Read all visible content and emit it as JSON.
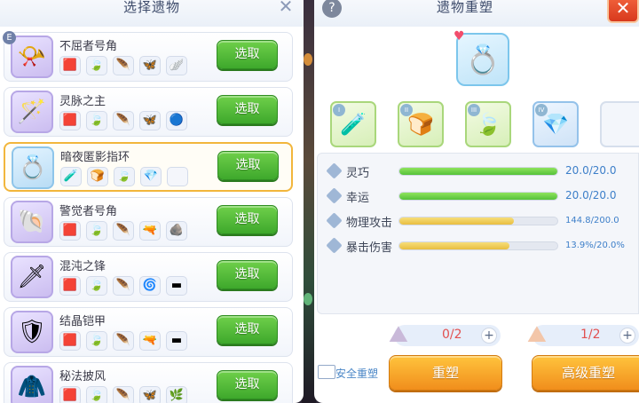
{
  "left_panel": {
    "title": "选择遗物",
    "close_icon": "close-icon",
    "badge": "E",
    "pick_label": "选取",
    "relics": [
      {
        "name": "不屈者号角",
        "icon": "horn",
        "glyph": "📯",
        "selected": false,
        "slots": [
          "🟥",
          "🍃",
          "🪶",
          "🦋",
          "🪽"
        ]
      },
      {
        "name": "灵脉之主",
        "icon": "staff",
        "glyph": "🪄",
        "selected": false,
        "slots": [
          "🟥",
          "🍃",
          "🪶",
          "🦋",
          "🔵"
        ]
      },
      {
        "name": "暗夜匿影指环",
        "icon": "ring",
        "glyph": "💍",
        "selected": true,
        "slots": [
          "🧪",
          "🍞",
          "🍃",
          "💎",
          ""
        ]
      },
      {
        "name": "警觉者号角",
        "icon": "horn-blue",
        "glyph": "🐚",
        "selected": false,
        "slots": [
          "🟥",
          "🍃",
          "🪶",
          "🔫",
          "🪨"
        ]
      },
      {
        "name": "混沌之锋",
        "icon": "blade",
        "glyph": "🗡",
        "selected": false,
        "slots": [
          "🟥",
          "🍃",
          "🪶",
          "🌀",
          "▬"
        ]
      },
      {
        "name": "结晶铠甲",
        "icon": "armor",
        "glyph": "🛡",
        "selected": false,
        "slots": [
          "🟥",
          "🍃",
          "🪶",
          "🔫",
          "▬"
        ]
      },
      {
        "name": "秘法披风",
        "icon": "cloak",
        "glyph": "🧥",
        "selected": false,
        "slots": [
          "🟥",
          "🍃",
          "🪶",
          "🦋",
          "🌿"
        ]
      }
    ]
  },
  "right_panel": {
    "title": "遗物重塑",
    "help_label": "?",
    "close_label": "✕",
    "main_relic": {
      "icon": "ring",
      "glyph": "💍",
      "heart": "♥"
    },
    "materials": [
      {
        "roman": "I",
        "glyph": "🧪",
        "icon": "potion"
      },
      {
        "roman": "II",
        "glyph": "🍞",
        "icon": "bread"
      },
      {
        "roman": "III",
        "glyph": "🍃",
        "icon": "leaf"
      },
      {
        "roman": "IV",
        "glyph": "💎",
        "icon": "crystal"
      },
      {
        "roman": "",
        "glyph": "",
        "icon": "empty-slot"
      }
    ],
    "stats": [
      {
        "label": "灵巧",
        "value": "20.0/20.0",
        "fraction": 1.0,
        "color": "green"
      },
      {
        "label": "幸运",
        "value": "20.0/20.0",
        "fraction": 1.0,
        "color": "green"
      },
      {
        "label": "物理攻击",
        "value": "144.8/200.0",
        "fraction": 0.724,
        "color": "gold"
      },
      {
        "label": "暴击伤害",
        "value": "13.9%/20.0%",
        "fraction": 0.695,
        "color": "gold"
      }
    ],
    "costs": [
      {
        "value": "0/2",
        "plus": "+",
        "icon": "dust-pile-icon"
      },
      {
        "value": "1/2",
        "plus": "+",
        "icon": "dust-pile-icon"
      }
    ],
    "safe_label": "安全重塑",
    "reforge_label": "重塑",
    "advanced_reforge_label": "高级重塑"
  }
}
